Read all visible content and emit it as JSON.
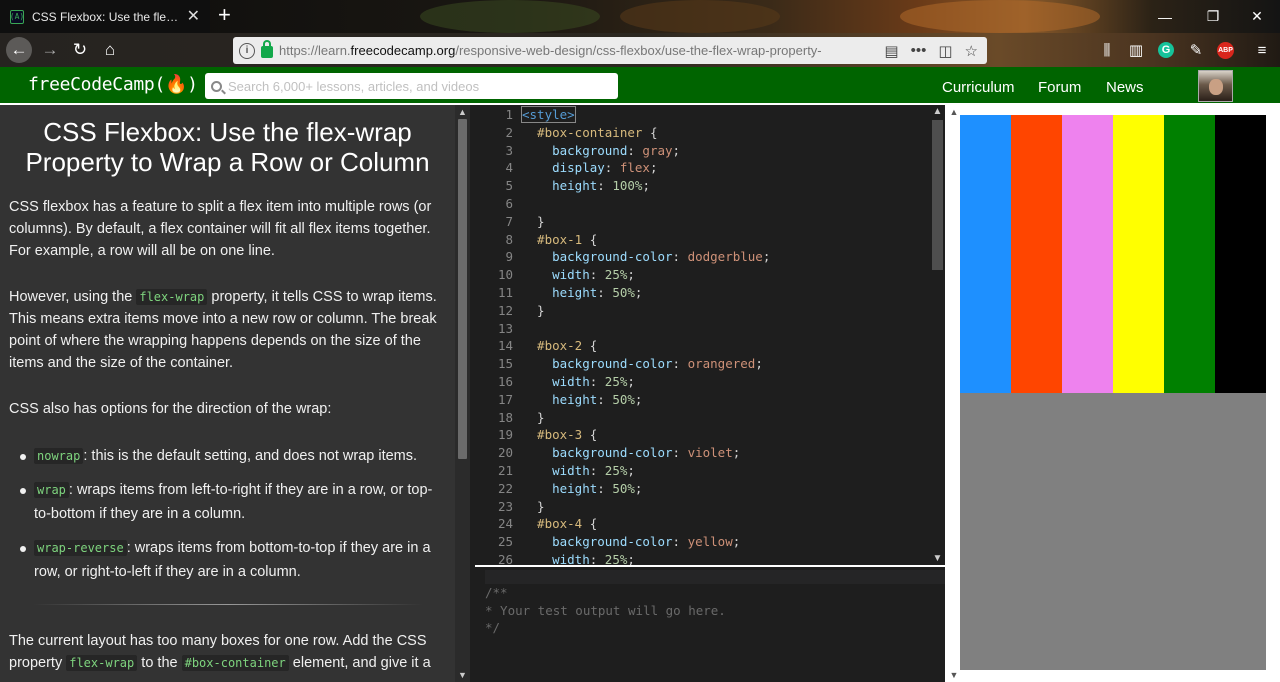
{
  "browser": {
    "tab_title": "CSS Flexbox: Use the flex-wrap",
    "favicon_text": "(A)",
    "url_prefix": "https://learn.",
    "url_domain": "freecodecamp.org",
    "url_path": "/responsive-web-design/css-flexbox/use-the-flex-wrap-property-"
  },
  "fcc_header": {
    "logo": "freeCodeCamp(🔥)",
    "search_placeholder": "Search 6,000+ lessons, articles, and videos",
    "nav": [
      "Curriculum",
      "Forum",
      "News"
    ]
  },
  "instructions": {
    "title": "CSS Flexbox: Use the flex-wrap Property to Wrap a Row or Column",
    "p1": "CSS flexbox has a feature to split a flex item into multiple rows (or columns). By default, a flex container will fit all flex items together. For example, a row will all be on one line.",
    "p2_before": "However, using the ",
    "p2_code": "flex-wrap",
    "p2_after": " property, it tells CSS to wrap items. This means extra items move into a new row or column. The break point of where the wrapping happens depends on the size of the items and the size of the container.",
    "p3": "CSS also has options for the direction of the wrap:",
    "list": [
      {
        "code": "nowrap",
        "text": ": this is the default setting, and does not wrap items."
      },
      {
        "code": "wrap",
        "text": ": wraps items from left-to-right if they are in a row, or top-to-bottom if they are in a column."
      },
      {
        "code": "wrap-reverse",
        "text": ": wraps items from bottom-to-top if they are in a row, or right-to-left if they are in a column."
      }
    ],
    "p4_a": "The current layout has too many boxes for one row. Add the CSS property ",
    "p4_code1": "flex-wrap",
    "p4_b": " to the ",
    "p4_code2": "#box-container",
    "p4_c": " element, and give it a"
  },
  "editor": {
    "lines": [
      [
        [
          "tag",
          "<style>"
        ]
      ],
      [
        [
          "sel",
          "  #box-container"
        ],
        [
          "p",
          " {"
        ]
      ],
      [
        [
          "prop",
          "    background"
        ],
        [
          "p",
          ": "
        ],
        [
          "val",
          "gray"
        ],
        [
          "p",
          ";"
        ]
      ],
      [
        [
          "prop",
          "    display"
        ],
        [
          "p",
          ": "
        ],
        [
          "val",
          "flex"
        ],
        [
          "p",
          ";"
        ]
      ],
      [
        [
          "prop",
          "    height"
        ],
        [
          "p",
          ": "
        ],
        [
          "num",
          "100%"
        ],
        [
          "p",
          ";"
        ]
      ],
      [
        [
          "p",
          ""
        ]
      ],
      [
        [
          "p",
          "  }"
        ]
      ],
      [
        [
          "sel",
          "  #box-1"
        ],
        [
          "p",
          " {"
        ]
      ],
      [
        [
          "prop",
          "    background-color"
        ],
        [
          "p",
          ": "
        ],
        [
          "val",
          "dodgerblue"
        ],
        [
          "p",
          ";"
        ]
      ],
      [
        [
          "prop",
          "    width"
        ],
        [
          "p",
          ": "
        ],
        [
          "num",
          "25%"
        ],
        [
          "p",
          ";"
        ]
      ],
      [
        [
          "prop",
          "    height"
        ],
        [
          "p",
          ": "
        ],
        [
          "num",
          "50%"
        ],
        [
          "p",
          ";"
        ]
      ],
      [
        [
          "p",
          "  }"
        ]
      ],
      [
        [
          "p",
          ""
        ]
      ],
      [
        [
          "sel",
          "  #box-2"
        ],
        [
          "p",
          " {"
        ]
      ],
      [
        [
          "prop",
          "    background-color"
        ],
        [
          "p",
          ": "
        ],
        [
          "val",
          "orangered"
        ],
        [
          "p",
          ";"
        ]
      ],
      [
        [
          "prop",
          "    width"
        ],
        [
          "p",
          ": "
        ],
        [
          "num",
          "25%"
        ],
        [
          "p",
          ";"
        ]
      ],
      [
        [
          "prop",
          "    height"
        ],
        [
          "p",
          ": "
        ],
        [
          "num",
          "50%"
        ],
        [
          "p",
          ";"
        ]
      ],
      [
        [
          "p",
          "  }"
        ]
      ],
      [
        [
          "sel",
          "  #box-3"
        ],
        [
          "p",
          " {"
        ]
      ],
      [
        [
          "prop",
          "    background-color"
        ],
        [
          "p",
          ": "
        ],
        [
          "val",
          "violet"
        ],
        [
          "p",
          ";"
        ]
      ],
      [
        [
          "prop",
          "    width"
        ],
        [
          "p",
          ": "
        ],
        [
          "num",
          "25%"
        ],
        [
          "p",
          ";"
        ]
      ],
      [
        [
          "prop",
          "    height"
        ],
        [
          "p",
          ": "
        ],
        [
          "num",
          "50%"
        ],
        [
          "p",
          ";"
        ]
      ],
      [
        [
          "p",
          "  }"
        ]
      ],
      [
        [
          "sel",
          "  #box-4"
        ],
        [
          "p",
          " {"
        ]
      ],
      [
        [
          "prop",
          "    background-color"
        ],
        [
          "p",
          ": "
        ],
        [
          "val",
          "yellow"
        ],
        [
          "p",
          ";"
        ]
      ],
      [
        [
          "prop",
          "    width"
        ],
        [
          "p",
          ": "
        ],
        [
          "num",
          "25%"
        ],
        [
          "p",
          ";"
        ]
      ]
    ]
  },
  "output": {
    "lines": [
      "/**",
      "* Your test output will go here.",
      "*/"
    ]
  },
  "preview": {
    "container_bg": "gray",
    "boxes": [
      "dodgerblue",
      "orangered",
      "violet",
      "yellow",
      "green",
      "black"
    ]
  }
}
